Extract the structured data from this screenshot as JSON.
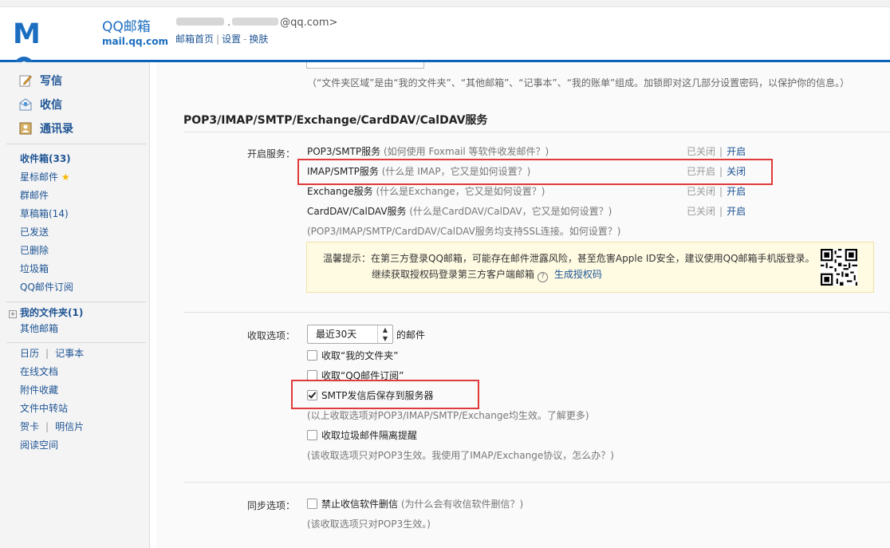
{
  "header": {
    "brand": "QQ邮箱",
    "domain": "mail.qq.com",
    "email_suffix": "@qq.com>",
    "links": [
      "邮箱首页",
      "设置",
      "换肤"
    ]
  },
  "sidebar": {
    "quick": [
      {
        "label": "写信",
        "icon": "pen-icon"
      },
      {
        "label": "收信",
        "icon": "inbox-icon"
      },
      {
        "label": "通讯录",
        "icon": "contacts-icon"
      }
    ],
    "folders": [
      "收件箱(33)",
      "星标邮件",
      "群邮件",
      "草稿箱(14)",
      "已发送",
      "已删除",
      "垃圾箱",
      "QQ邮件订阅"
    ],
    "my_folders": "我的文件夹(1)",
    "other_mailbox": "其他邮箱",
    "tools": {
      "calendar": "日历",
      "notes": "记事本",
      "online_docs": "在线文档",
      "attachments": "附件收藏",
      "file_transfer": "文件中转站",
      "cards": "贺卡",
      "postcards": "明信片",
      "reading": "阅读空间"
    }
  },
  "main": {
    "folder_note": "（“文件夹区域”是由“我的文件夹”、“其他邮箱”、“记事本”、“我的账单”组成。加锁即对这几部分设置密码，以保护你的信息。）",
    "section_title": "POP3/IMAP/SMTP/Exchange/CardDAV/CalDAV服务",
    "service_label": "开启服务：",
    "services": [
      {
        "name": "POP3/SMTP服务",
        "hint": " (如何使用 Foxmail 等软件收发邮件？)",
        "status": "已关闭",
        "action": "开启"
      },
      {
        "name": "IMAP/SMTP服务",
        "hint": " (什么是 IMAP，它又是如何设置？)",
        "status": "已开启",
        "action": "关闭"
      },
      {
        "name": "Exchange服务",
        "hint": " (什么是Exchange，它又是如何设置？)",
        "status": "已关闭",
        "action": "开启"
      },
      {
        "name": "CardDAV/CalDAV服务",
        "hint": " (什么是CardDAV/CalDAV，它又是如何设置？)",
        "status": "已关闭",
        "action": "开启"
      }
    ],
    "ssl_note": "(POP3/IMAP/SMTP/CardDAV/CalDAV服务均支持SSL连接。如何设置？)",
    "tip_line1": "温馨提示：在第三方登录QQ邮箱，可能存在邮件泄露风险，甚至危害Apple ID安全，建议使用QQ邮箱手机版登录。",
    "tip_line2a": "继续获取授权码登录第三方客户端邮箱",
    "tip_qmark": "?",
    "tip_link": "生成授权码",
    "receive_label": "收取选项：",
    "receive_select": "最近30天",
    "receive_suffix": "的邮件",
    "receive_options": [
      {
        "label": "收取“我的文件夹”",
        "checked": false
      },
      {
        "label": "收取“QQ邮件订阅”",
        "checked": false
      },
      {
        "label": "SMTP发信后保存到服务器",
        "checked": true
      }
    ],
    "receive_note1": "(以上收取选项对POP3/IMAP/SMTP/Exchange均生效。了解更多)",
    "spam_option": "收取垃圾邮件隔离提醒",
    "receive_note2": "(该收取选项只对POP3生效。我使用了IMAP/Exchange协议，怎么办？)",
    "sync_label": "同步选项：",
    "sync_option": "禁止收信软件删信",
    "sync_hint": " (为什么会有收信软件删信？)",
    "sync_note": "(该收取选项只对POP3生效。)"
  }
}
